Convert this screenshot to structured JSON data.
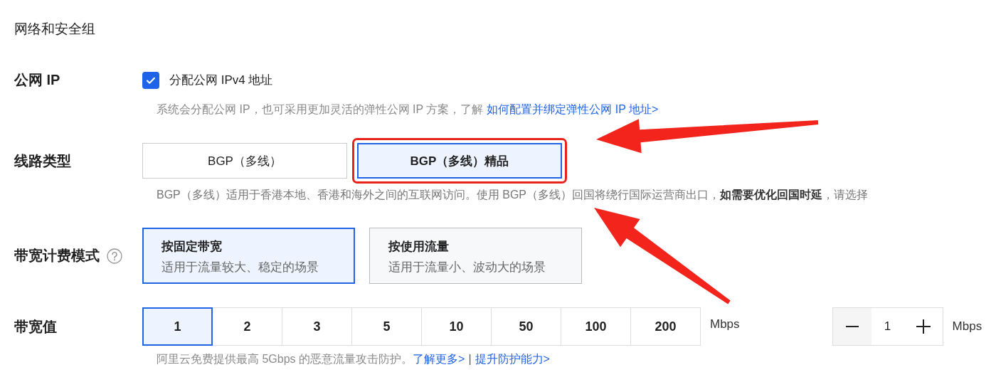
{
  "section_title": "网络和安全组",
  "public_ip": {
    "label": "公网 IP",
    "checkbox": {
      "label": "分配公网 IPv4 地址",
      "checked": true
    },
    "hint": "系统会分配公网 IP，也可采用更加灵活的弹性公网 IP 方案，了解",
    "hint_link": "如何配置并绑定弹性公网 IP 地址>"
  },
  "line_type": {
    "label": "线路类型",
    "options": [
      {
        "label": "BGP（多线）",
        "selected": false,
        "highlighted": false
      },
      {
        "label": "BGP（多线）精品",
        "selected": true,
        "highlighted": true
      }
    ],
    "description": "BGP（多线）适用于香港本地、香港和海外之间的互联网访问。使用 BGP（多线）回国将绕行国际运营商出口，**如需要优化回国时延**，请选择"
  },
  "billing_mode": {
    "label": "带宽计费模式",
    "options": [
      {
        "title": "按固定带宽",
        "subtitle": "适用于流量较大、稳定的场景",
        "selected": true
      },
      {
        "title": "按使用流量",
        "subtitle": "适用于流量小、波动大的场景",
        "selected": false
      }
    ]
  },
  "bandwidth": {
    "label": "带宽值",
    "options": [
      {
        "label": "1",
        "selected": true
      },
      {
        "label": "2",
        "selected": false
      },
      {
        "label": "3",
        "selected": false
      },
      {
        "label": "5",
        "selected": false
      },
      {
        "label": "10",
        "selected": false
      },
      {
        "label": "50",
        "selected": false
      },
      {
        "label": "100",
        "selected": false
      },
      {
        "label": "200",
        "selected": false
      }
    ],
    "unit": "Mbps",
    "stepper": {
      "value": "1",
      "unit": "Mbps"
    },
    "hint": "阿里云免费提供最高 5Gbps 的恶意流量攻击防护。",
    "links": [
      "了解更多>",
      "提升防护能力>"
    ],
    "separator": "|"
  }
}
